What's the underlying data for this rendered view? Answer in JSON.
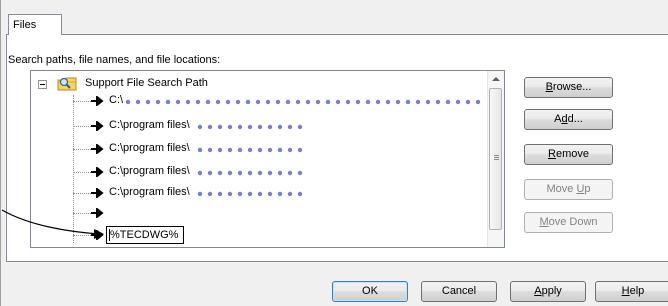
{
  "tab": {
    "label": "Files"
  },
  "panel": {
    "label": "Search paths, file names, and file locations:"
  },
  "tree": {
    "root": {
      "label": "Support File Search Path",
      "icon": "folder-search-icon"
    },
    "items": [
      {
        "label": "C:\\"
      },
      {
        "label": "C:\\program files\\"
      },
      {
        "label": "C:\\program files\\"
      },
      {
        "label": "C:\\program files\\"
      },
      {
        "label": "C:\\program files\\"
      },
      {
        "label": ""
      }
    ],
    "edit_value": "%TECDWG%"
  },
  "buttons": {
    "browse": {
      "pre": "",
      "key": "B",
      "post": "rowse..."
    },
    "add": {
      "pre": "A",
      "key": "d",
      "post": "d..."
    },
    "remove": {
      "pre": "",
      "key": "R",
      "post": "emove"
    },
    "move_up": {
      "pre": "Move ",
      "key": "U",
      "post": "p"
    },
    "move_down": {
      "pre": "",
      "key": "M",
      "post": "ove Down"
    }
  },
  "footer": {
    "ok": "OK",
    "cancel": "Cancel",
    "apply": {
      "key": "A",
      "post": "pply"
    },
    "help": {
      "key": "H",
      "post": "elp"
    }
  },
  "colors": {
    "obscured_dots": "#7a7ec8",
    "arrow": "#000000",
    "focus_border": "#3c7fb1"
  }
}
